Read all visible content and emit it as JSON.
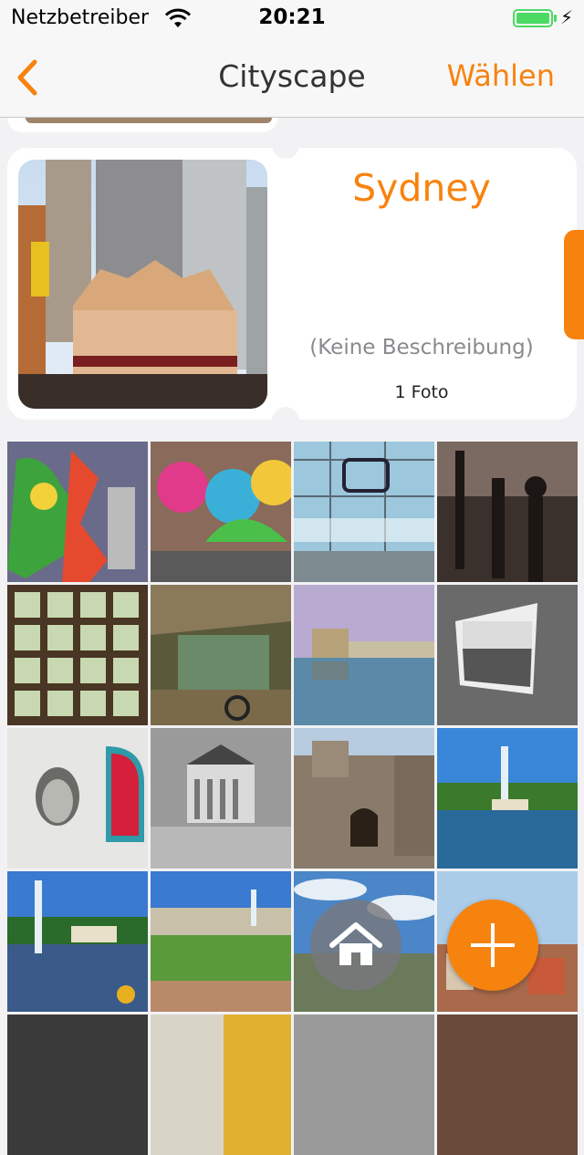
{
  "status_bar": {
    "carrier": "Netzbetreiber",
    "time": "20:21"
  },
  "nav": {
    "title": "Cityscape",
    "select_label": "Wählen",
    "accent_color": "#f7830f"
  },
  "album": {
    "name": "Sydney",
    "description": "(Keine Beschreibung)",
    "photo_count": "1 Foto"
  },
  "photo_grid": {
    "rows": [
      [
        "graffiti-mural",
        "graffiti-wall",
        "berlin-hauptbahnhof",
        "iron-fence"
      ],
      [
        "window-vases",
        "abandoned-room",
        "harbor-reflection",
        "broken-window"
      ],
      [
        "face-graffiti",
        "concert-hall",
        "castle-gate",
        "fountain-park"
      ],
      [
        "fountain-palace",
        "palace-garden",
        "clouds-sky",
        "town-view"
      ]
    ]
  },
  "icons": {
    "home": "home-icon",
    "add": "plus-icon",
    "back": "chevron-left-icon",
    "wifi": "wifi-icon",
    "battery": "battery-icon"
  }
}
